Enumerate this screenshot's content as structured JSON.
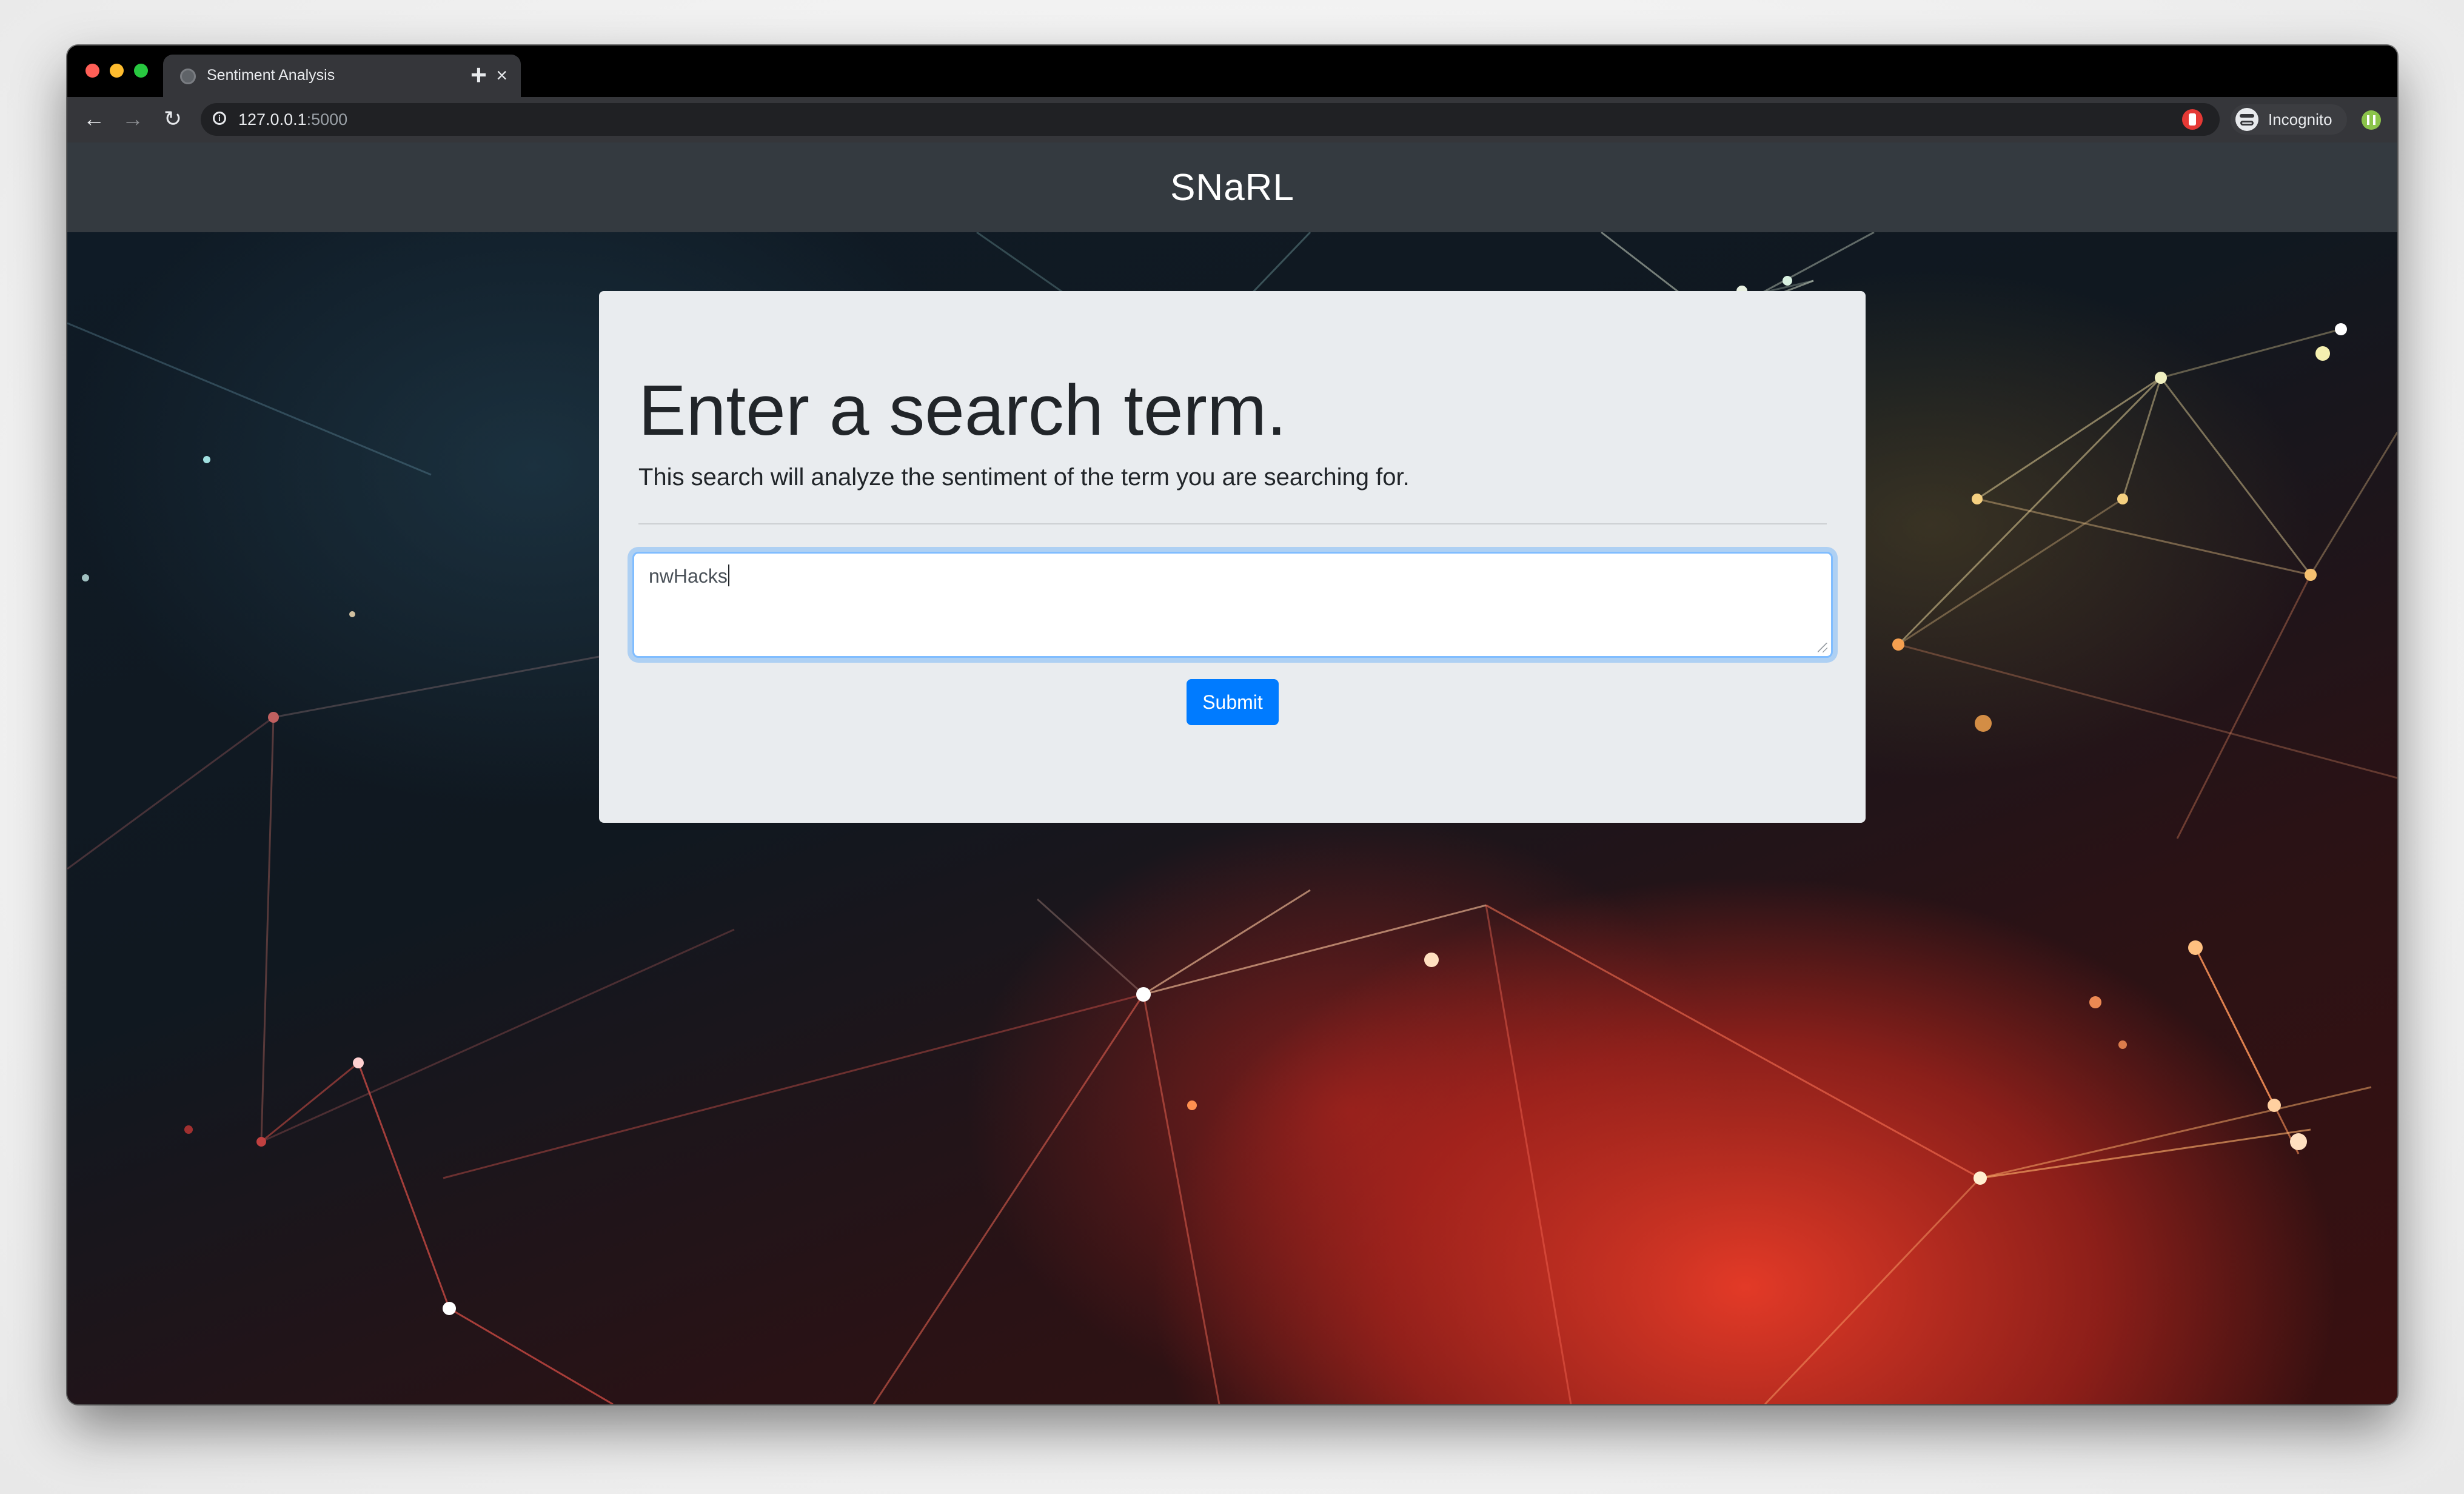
{
  "browser": {
    "tab": {
      "title": "Sentiment Analysis",
      "close_glyph": "×",
      "favicon": "globe-icon"
    },
    "new_tab_glyph": "+",
    "nav": {
      "back_glyph": "←",
      "forward_glyph": "→",
      "reload_glyph": "↻"
    },
    "url": {
      "host": "127.0.0.1",
      "port": ":5000"
    },
    "bookmark_glyph": "☆",
    "profile": {
      "label": "Incognito"
    }
  },
  "site": {
    "brand": "SNaRL"
  },
  "jumbotron": {
    "title": "Enter a search term.",
    "lead": "This search will analyze the sentiment of the term you are searching for.",
    "search_value": "nwHacks",
    "submit_label": "Submit"
  },
  "colors": {
    "navbar": "#343a40",
    "jumbotron": "#e9ecef",
    "primary": "#007bff",
    "focus_border": "#80bdff"
  }
}
